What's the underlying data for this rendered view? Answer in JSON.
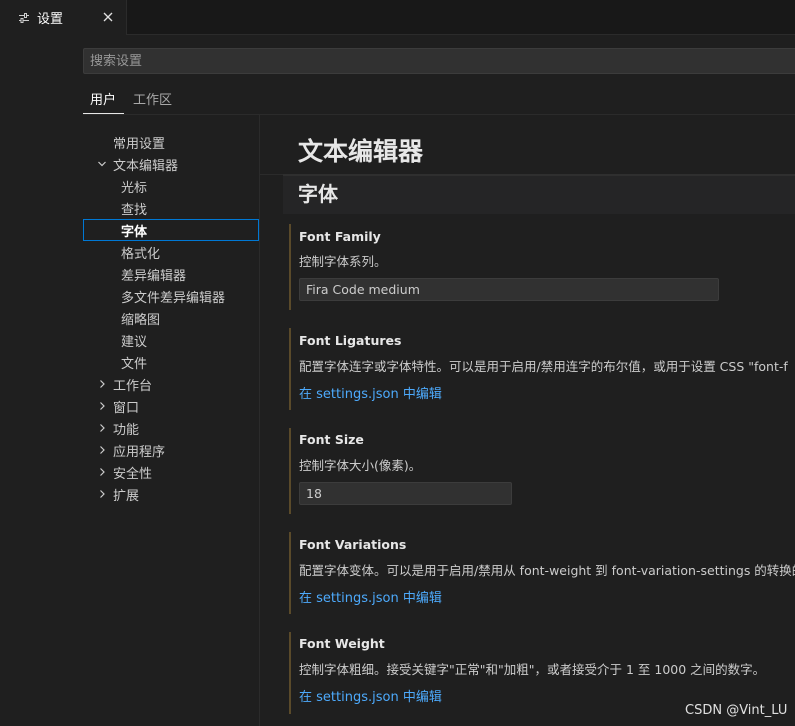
{
  "tab": {
    "title": "设置",
    "close_icon": "close-icon",
    "icon": "settings-editor-icon"
  },
  "search": {
    "placeholder": "搜索设置",
    "value": ""
  },
  "scope_tabs": [
    {
      "label": "用户",
      "active": true
    },
    {
      "label": "工作区",
      "active": false
    }
  ],
  "toc": {
    "items": [
      {
        "label": "常用设置"
      },
      {
        "label": "文本编辑器",
        "expanded": true
      },
      {
        "label": "光标"
      },
      {
        "label": "查找"
      },
      {
        "label": "字体",
        "selected": true
      },
      {
        "label": "格式化"
      },
      {
        "label": "差异编辑器"
      },
      {
        "label": "多文件差异编辑器"
      },
      {
        "label": "缩略图"
      },
      {
        "label": "建议"
      },
      {
        "label": "文件"
      },
      {
        "label": "工作台"
      },
      {
        "label": "窗口"
      },
      {
        "label": "功能"
      },
      {
        "label": "应用程序"
      },
      {
        "label": "安全性"
      },
      {
        "label": "扩展"
      }
    ]
  },
  "main": {
    "title": "文本编辑器",
    "section": "字体",
    "settings": [
      {
        "title": "Font Family",
        "desc": "控制字体系列。",
        "value": "Fira Code medium"
      },
      {
        "title": "Font Ligatures",
        "desc": "配置字体连字或字体特性。可以是用于启用/禁用连字的布尔值，或用于设置 CSS \"font-f",
        "link": "在 settings.json 中编辑"
      },
      {
        "title": "Font Size",
        "desc": "控制字体大小(像素)。",
        "value": "18"
      },
      {
        "title": "Font Variations",
        "desc": "配置字体变体。可以是用于启用/禁用从 font-weight 到 font-variation-settings 的转换的",
        "link": "在 settings.json 中编辑"
      },
      {
        "title": "Font Weight",
        "desc": "控制字体粗细。接受关键字\"正常\"和\"加粗\"，或者接受介于 1 至 1000 之间的数字。",
        "link": "在 settings.json 中编辑"
      }
    ]
  },
  "watermark": "CSDN @Vint_LU",
  "colors": {
    "accent": "#0078d4",
    "link": "#4daafc",
    "background": "#1f1f1f"
  }
}
